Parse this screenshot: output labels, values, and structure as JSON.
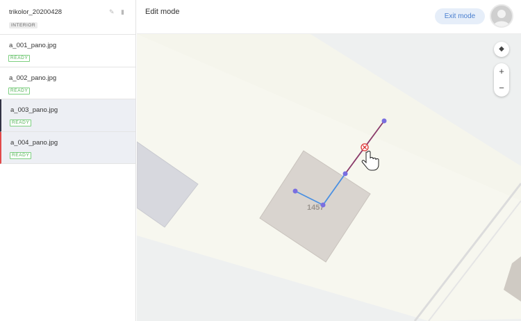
{
  "project": {
    "title": "trikolor_20200428",
    "tag": "INTERIOR"
  },
  "files": [
    {
      "name": "a_001_pano.jpg",
      "status": "READY"
    },
    {
      "name": "a_002_pano.jpg",
      "status": "READY"
    },
    {
      "name": "a_003_pano.jpg",
      "status": "READY"
    },
    {
      "name": "a_004_pano.jpg",
      "status": "READY"
    }
  ],
  "header": {
    "mode_label": "Edit mode",
    "exit_label": "Exit mode"
  },
  "map": {
    "building_number": "1457",
    "zoom_in": "+",
    "zoom_out": "−"
  },
  "colors": {
    "accent": "#4a7fcf",
    "ready": "#4caf50",
    "selected_line": "#8a3a6a",
    "path": "#4a90e2",
    "node": "#7a6fe0"
  }
}
